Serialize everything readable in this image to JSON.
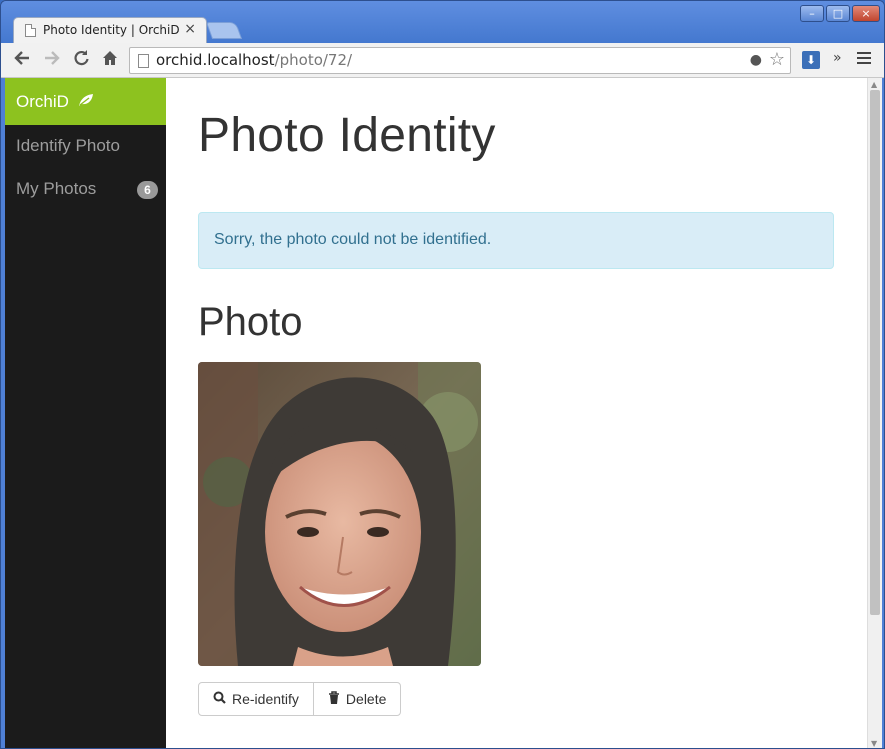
{
  "browser": {
    "tab_title": "Photo Identity | OrchiD",
    "tab_close": "×",
    "url_host": "orchid.localhost",
    "url_path": "/photo/72/",
    "back_icon": "arrow-left-icon",
    "forward_icon": "arrow-right-icon",
    "reload_icon": "reload-icon",
    "home_icon": "home-icon",
    "overflow_label": "»"
  },
  "window_controls": {
    "minimize": "–",
    "maximize": "□",
    "close": "×"
  },
  "sidebar": {
    "brand": "OrchiD",
    "brand_icon": "leaf-icon",
    "brand_color": "#8dc21f",
    "items": [
      {
        "label": "Identify Photo"
      },
      {
        "label": "My Photos",
        "badge": "6"
      }
    ]
  },
  "main": {
    "page_title": "Photo Identity",
    "alert_text": "Sorry, the photo could not be identified.",
    "section_title": "Photo",
    "photo_alt": "photo of a smiling woman",
    "buttons": {
      "reidentify": {
        "label": "Re-identify",
        "icon": "search-icon"
      },
      "delete": {
        "label": "Delete",
        "icon": "trash-icon"
      }
    }
  }
}
